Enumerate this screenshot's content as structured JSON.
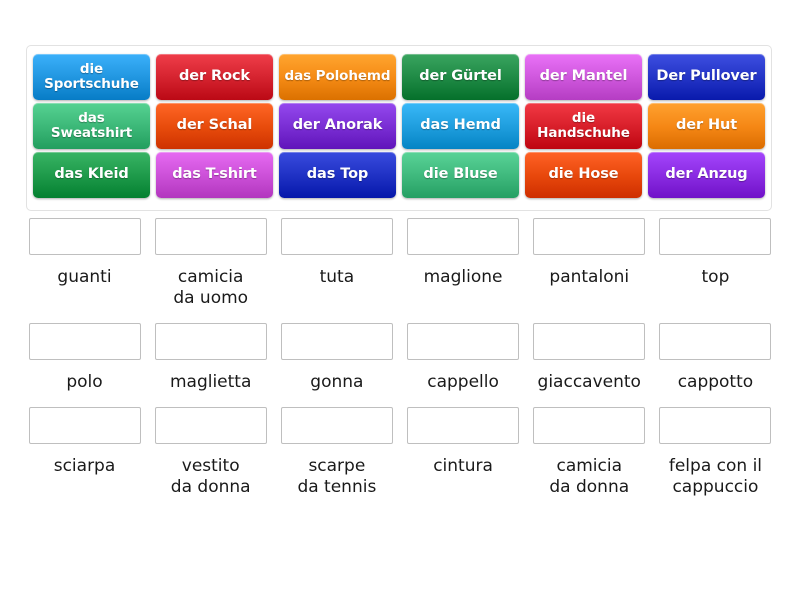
{
  "activity": {
    "type": "match-up",
    "language_pair": "German to Italian",
    "topic": "clothing"
  },
  "colors": {
    "tile_blue_light": "#2196e0",
    "tile_red": "#d5232f",
    "tile_orange": "#f58b15",
    "tile_green_dark": "#1f8a45",
    "tile_orchid": "#cf57dd",
    "tile_blue_dark": "#2334c6",
    "tile_green_sea": "#3cb878",
    "tile_orange_red": "#e84c0c",
    "tile_purple": "#7a2ed4",
    "tile_sky": "#1f9ede",
    "tile_crimson": "#d81f2a",
    "tile_orange2": "#f58715",
    "tile_forest": "#1e9a4a",
    "tile_magenta": "#cc50d8",
    "tile_indigo": "#1f31c4",
    "tile_emerald": "#3fb97d",
    "tile_vermilion": "#e8480c",
    "tile_violet": "#8a2be2",
    "drop_border": "#bfbfbf",
    "tray_border": "#e2e2e2",
    "label_text": "#1a1a1a",
    "page_background": "#ffffff"
  },
  "tiles": [
    [
      {
        "label": "die\nSportschuhe",
        "color": "#2196e0",
        "two_line": true
      },
      {
        "label": "der Rock",
        "color": "#d5232f",
        "two_line": false
      },
      {
        "label": "das\nPolohemd",
        "color": "#f58b15",
        "two_line": true
      },
      {
        "label": "der Gürtel",
        "color": "#1f8a45",
        "two_line": false
      },
      {
        "label": "der Mantel",
        "color": "#cf57dd",
        "two_line": false
      },
      {
        "label": "Der Pullover",
        "color": "#2334c6",
        "two_line": false
      }
    ],
    [
      {
        "label": "das\nSweatshirt",
        "color": "#3cb878",
        "two_line": true
      },
      {
        "label": "der Schal",
        "color": "#e84c0c",
        "two_line": false
      },
      {
        "label": "der Anorak",
        "color": "#7a2ed4",
        "two_line": false
      },
      {
        "label": "das Hemd",
        "color": "#1f9ede",
        "two_line": false
      },
      {
        "label": "die\nHandschuhe",
        "color": "#d81f2a",
        "two_line": true
      },
      {
        "label": "der Hut",
        "color": "#f58715",
        "two_line": false
      }
    ],
    [
      {
        "label": "das Kleid",
        "color": "#1e9a4a",
        "two_line": false
      },
      {
        "label": "das T-shirt",
        "color": "#cc50d8",
        "two_line": false
      },
      {
        "label": "das Top",
        "color": "#1f31c4",
        "two_line": false
      },
      {
        "label": "die Bluse",
        "color": "#3fb97d",
        "two_line": false
      },
      {
        "label": "die Hose",
        "color": "#e8480c",
        "two_line": false
      },
      {
        "label": "der Anzug",
        "color": "#8a2be2",
        "two_line": false
      }
    ]
  ],
  "answers": [
    [
      {
        "label": "guanti"
      },
      {
        "label": "camicia\nda uomo"
      },
      {
        "label": "tuta"
      },
      {
        "label": "maglione"
      },
      {
        "label": "pantaloni"
      },
      {
        "label": "top"
      }
    ],
    [
      {
        "label": "polo"
      },
      {
        "label": "maglietta"
      },
      {
        "label": "gonna"
      },
      {
        "label": "cappello"
      },
      {
        "label": "giaccavento"
      },
      {
        "label": "cappotto"
      }
    ],
    [
      {
        "label": "sciarpa"
      },
      {
        "label": "vestito\nda donna"
      },
      {
        "label": "scarpe\nda tennis"
      },
      {
        "label": "cintura"
      },
      {
        "label": "camicia\nda donna"
      },
      {
        "label": "felpa con il\ncappuccio"
      }
    ]
  ]
}
